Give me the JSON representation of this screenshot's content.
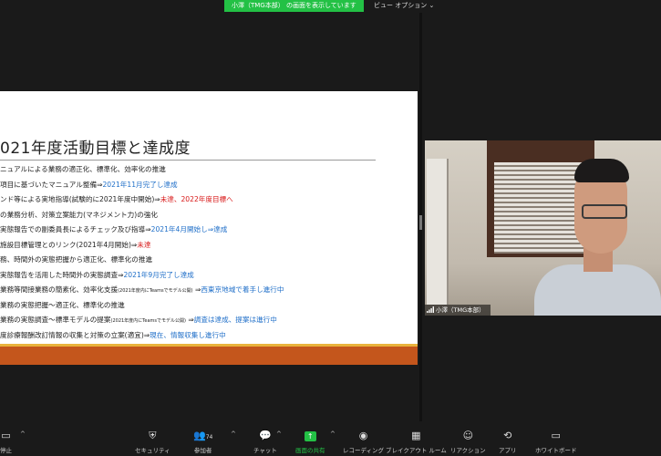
{
  "topbar": {
    "share_banner": "小澤（TMG本部） の画面を表示しています",
    "view_options": "ビュー オプション ⌄"
  },
  "slide": {
    "title": "021年度活動目標と達成度",
    "lines": [
      {
        "a": "ニュアルによる業務の適正化、標準化、効率化の推進",
        "b": "",
        "c": "",
        "d": ""
      },
      {
        "a": "項目に基づいたマニュアル整備⇒",
        "b": "2021年11月完了し達成",
        "c": "",
        "d": ""
      },
      {
        "a": "ンド等による実地指導(試験的に2021年度中開始)⇒",
        "b": "",
        "c": "未達、2022年度目標へ",
        "d": ""
      },
      {
        "a": "の業務分析、対策立案能力(マネジメント力)の強化",
        "b": "",
        "c": "",
        "d": ""
      },
      {
        "a": "実態報告での副委員長によるチェック及び指導⇒",
        "b": "2021年4月開始し⇒達成",
        "c": "",
        "d": ""
      },
      {
        "a": "施設目標管理とのリンク(2021年4月開始)⇒",
        "b": "",
        "c": "未達",
        "d": ""
      },
      {
        "a": "務、時間外の実態把握から適正化、標準化の推進",
        "b": "",
        "c": "",
        "d": ""
      },
      {
        "a": "実態報告を活用した時間外の実態調査⇒",
        "b": "2021年9月完了し達成",
        "c": "",
        "d": ""
      },
      {
        "a": "業務等間接業務の簡素化、効率化支援",
        "s": "(2021年度内にTeamsでモデル公開)",
        "e": " ⇒",
        "b": "西東京地域で着手し進行中",
        "c": "",
        "d": ""
      },
      {
        "a": "業務の実態把握～適正化、標準化の推進",
        "b": "",
        "c": "",
        "d": ""
      },
      {
        "a": "業務の実態調査～標準モデルの提案",
        "s": "(2021年度内にTeamsでモデル公開)",
        "e": " ⇒",
        "b": "調査は達成、提案は進行中",
        "c": "",
        "d": ""
      },
      {
        "a": "度診療報酬改訂情報の収集と対策の立案(適宜)⇒",
        "b": "現在、情報収集し進行中",
        "c": "",
        "d": ""
      }
    ]
  },
  "video": {
    "participant_name": "小澤（TMG本部）"
  },
  "toolbar": {
    "stop": "停止",
    "security": "セキュリティ",
    "participants": "参加者",
    "participants_count": "74",
    "chat": "チャット",
    "share": "画面の共有",
    "record": "レコーディング",
    "breakout": "ブレイクアウト ルーム",
    "reactions": "リアクション",
    "apps": "アプリ",
    "whiteboard": "ホワイトボード"
  },
  "colors": {
    "share_green": "#23c145",
    "progress_blue": "#1e6ec8",
    "unmet_red": "#d81818",
    "slide_footer": "#c4561c",
    "slide_accent": "#e9b33c"
  }
}
